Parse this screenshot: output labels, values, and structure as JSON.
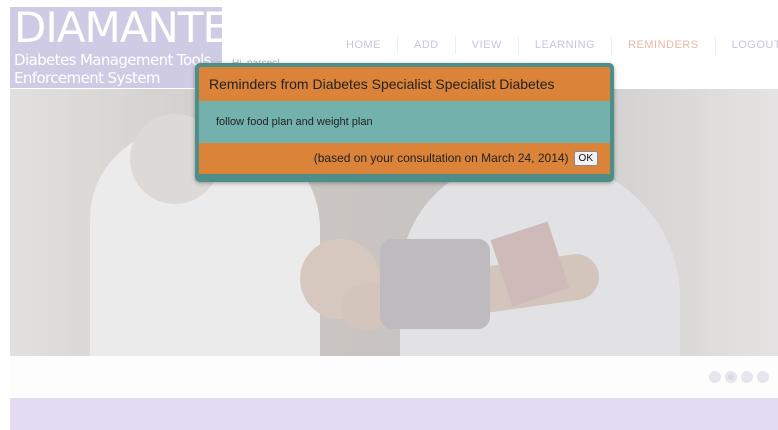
{
  "logo": {
    "title": "DIAMANTES",
    "subtitle_line1": "Diabetes Management Tools",
    "subtitle_line2": "Enforcement System"
  },
  "user_label": "Hi, parsec!",
  "nav": {
    "items": [
      {
        "label": "HOME",
        "active": false
      },
      {
        "label": "ADD",
        "active": false
      },
      {
        "label": "VIEW",
        "active": false
      },
      {
        "label": "LEARNING",
        "active": false
      },
      {
        "label": "REMINDERS",
        "active": true
      },
      {
        "label": "LOGOUT",
        "active": false
      }
    ]
  },
  "modal": {
    "title": "Reminders from Diabetes Specialist Specialist Diabetes",
    "message": "follow food plan and weight plan",
    "consultation_note": "(based on your consultation on March 24, 2014)",
    "ok_label": "OK"
  },
  "carousel": {
    "dot_count": 4,
    "selected_index": 1
  },
  "colors": {
    "modal_border": "#4e8d88",
    "modal_header": "#db8339",
    "modal_body": "#73b1ac",
    "footer_bar": "#e4dcf3",
    "nav_active": "#ebb8a2"
  }
}
